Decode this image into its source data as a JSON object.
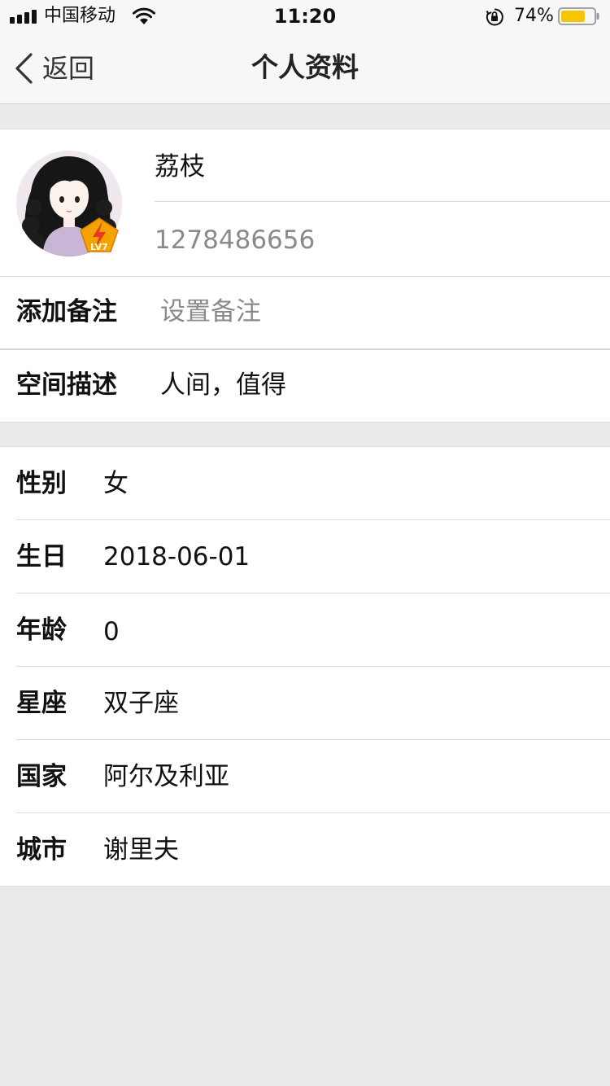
{
  "status_bar": {
    "carrier": "中国移动",
    "time": "11:20",
    "battery_percent": "74%",
    "battery_level": 0.74,
    "battery_color": "#f5c600",
    "icons": [
      "signal-icon",
      "wifi-icon",
      "orientation-lock-icon",
      "battery-icon"
    ]
  },
  "nav": {
    "back_label": "返回",
    "title": "个人资料"
  },
  "profile": {
    "nickname": "荔枝",
    "user_id": "1278486656",
    "level_badge": "LV7"
  },
  "remark": {
    "label": "添加备注",
    "placeholder": "设置备注"
  },
  "space_desc": {
    "label": "空间描述",
    "value": "人间，值得"
  },
  "info_rows": [
    {
      "label": "性别",
      "value": "女"
    },
    {
      "label": "生日",
      "value": "2018-06-01"
    },
    {
      "label": "年龄",
      "value": "0"
    },
    {
      "label": "星座",
      "value": "双子座"
    },
    {
      "label": "国家",
      "value": "阿尔及利亚"
    },
    {
      "label": "城市",
      "value": "谢里夫"
    }
  ]
}
